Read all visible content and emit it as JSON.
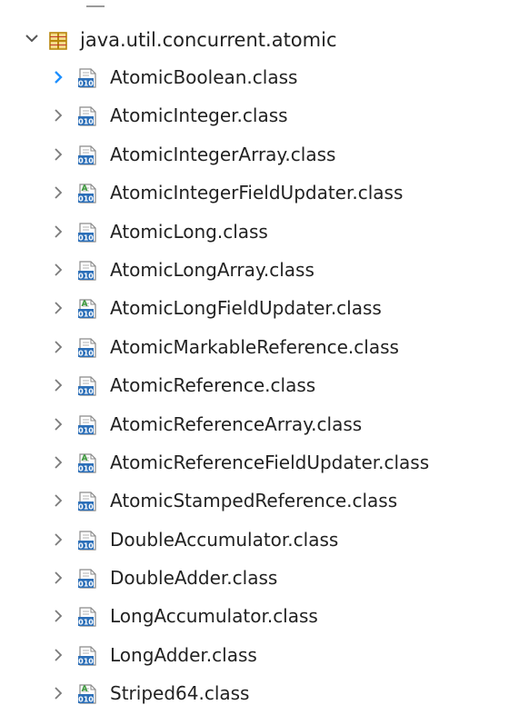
{
  "package": {
    "name": "java.util.concurrent.atomic",
    "expanded": true,
    "twisty_icon": "chevron-down-icon",
    "icon": "package-icon",
    "icon_color": "#b8860b"
  },
  "colors": {
    "twisty_selected": "#1e90ff",
    "twisty_default": "#7a7a7a",
    "class_icon_blue": "#2c6fb8",
    "abstract_badge_green": "#3a9a3a"
  },
  "items": [
    {
      "label": "AtomicBoolean.class",
      "icon": "class-file-icon",
      "abstract": false,
      "twisty": "chevron-right-icon",
      "highlighted_twisty": true
    },
    {
      "label": "AtomicInteger.class",
      "icon": "class-file-icon",
      "abstract": false,
      "twisty": "chevron-right-icon",
      "highlighted_twisty": false
    },
    {
      "label": "AtomicIntegerArray.class",
      "icon": "class-file-icon",
      "abstract": false,
      "twisty": "chevron-right-icon",
      "highlighted_twisty": false
    },
    {
      "label": "AtomicIntegerFieldUpdater.class",
      "icon": "abstract-class-file-icon",
      "abstract": true,
      "twisty": "chevron-right-icon",
      "highlighted_twisty": false
    },
    {
      "label": "AtomicLong.class",
      "icon": "class-file-icon",
      "abstract": false,
      "twisty": "chevron-right-icon",
      "highlighted_twisty": false
    },
    {
      "label": "AtomicLongArray.class",
      "icon": "class-file-icon",
      "abstract": false,
      "twisty": "chevron-right-icon",
      "highlighted_twisty": false
    },
    {
      "label": "AtomicLongFieldUpdater.class",
      "icon": "abstract-class-file-icon",
      "abstract": true,
      "twisty": "chevron-right-icon",
      "highlighted_twisty": false
    },
    {
      "label": "AtomicMarkableReference.class",
      "icon": "class-file-icon",
      "abstract": false,
      "twisty": "chevron-right-icon",
      "highlighted_twisty": false
    },
    {
      "label": "AtomicReference.class",
      "icon": "class-file-icon",
      "abstract": false,
      "twisty": "chevron-right-icon",
      "highlighted_twisty": false
    },
    {
      "label": "AtomicReferenceArray.class",
      "icon": "class-file-icon",
      "abstract": false,
      "twisty": "chevron-right-icon",
      "highlighted_twisty": false
    },
    {
      "label": "AtomicReferenceFieldUpdater.class",
      "icon": "abstract-class-file-icon",
      "abstract": true,
      "twisty": "chevron-right-icon",
      "highlighted_twisty": false
    },
    {
      "label": "AtomicStampedReference.class",
      "icon": "class-file-icon",
      "abstract": false,
      "twisty": "chevron-right-icon",
      "highlighted_twisty": false
    },
    {
      "label": "DoubleAccumulator.class",
      "icon": "class-file-icon",
      "abstract": false,
      "twisty": "chevron-right-icon",
      "highlighted_twisty": false
    },
    {
      "label": "DoubleAdder.class",
      "icon": "class-file-icon",
      "abstract": false,
      "twisty": "chevron-right-icon",
      "highlighted_twisty": false
    },
    {
      "label": "LongAccumulator.class",
      "icon": "class-file-icon",
      "abstract": false,
      "twisty": "chevron-right-icon",
      "highlighted_twisty": false
    },
    {
      "label": "LongAdder.class",
      "icon": "class-file-icon",
      "abstract": false,
      "twisty": "chevron-right-icon",
      "highlighted_twisty": false
    },
    {
      "label": "Striped64.class",
      "icon": "abstract-class-file-icon",
      "abstract": true,
      "twisty": "chevron-right-icon",
      "highlighted_twisty": false
    }
  ]
}
